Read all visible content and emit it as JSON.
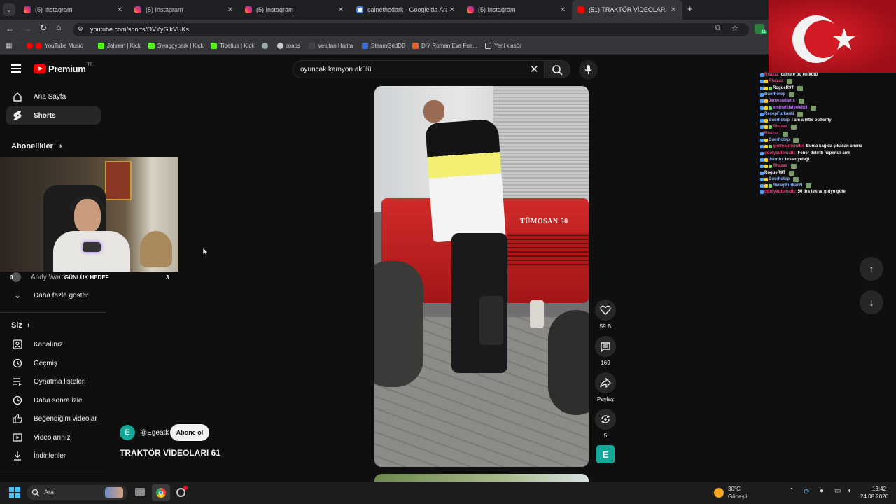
{
  "browser": {
    "tabs": [
      {
        "title": "(5) Instagram",
        "icon": "instagram-icon"
      },
      {
        "title": "(5) Instagram",
        "icon": "instagram-icon"
      },
      {
        "title": "(5) Instagram",
        "icon": "instagram-icon"
      },
      {
        "title": "cainethedark - Google'da Ara",
        "icon": "google-icon"
      },
      {
        "title": "(5) Instagram",
        "icon": "instagram-icon"
      },
      {
        "title": "(51) TRAKTÖR VİDEOLARI 6",
        "icon": "youtube-icon",
        "active": true
      }
    ],
    "new_tab": "+",
    "url": "youtube.com/shorts/OVYyGikVUKs",
    "bookmarks": [
      "YouTube Music",
      "Jahrein | Kick",
      "Swaggybark | Kick",
      "Tibetius | Kick",
      "roads",
      "Velutan Harita",
      "SteamGridDB",
      "DIY Roman Eva Foa...",
      "Yeni klasör"
    ],
    "extension_badge": "11"
  },
  "youtube": {
    "logo_text": "Premium",
    "logo_sup": "TR",
    "search_value": "oyuncak kamyon akülü",
    "nav": [
      {
        "label": "Ana Sayfa",
        "icon": "home-icon"
      },
      {
        "label": "Shorts",
        "icon": "shorts-icon",
        "active": true
      }
    ],
    "subscriptions_header": "Abonelikler",
    "subscription_partial": "Andy Ward",
    "show_more": "Daha fazla göster",
    "you_header": "Siz",
    "you_items": [
      {
        "label": "Kanalınız",
        "icon": "channel-icon"
      },
      {
        "label": "Geçmiş",
        "icon": "history-icon"
      },
      {
        "label": "Oynatma listeleri",
        "icon": "playlist-icon"
      },
      {
        "label": "Daha sonra izle",
        "icon": "clock-icon"
      },
      {
        "label": "Beğendiğim videolar",
        "icon": "like-icon"
      },
      {
        "label": "Videolarınız",
        "icon": "video-icon"
      },
      {
        "label": "İndirilenler",
        "icon": "download-icon"
      }
    ],
    "short": {
      "channel_initial": "E",
      "channel": "@Egeatk",
      "subscribe": "Abone ol",
      "title": "TRAKTÖR VİDEOLARI 61",
      "tractor_brand": "TÜMOSAN 50",
      "likes": "59 B",
      "comments": "169",
      "share": "Paylaş",
      "remix": "5",
      "avatar_initial": "E"
    }
  },
  "overlay": {
    "goal_label": "GÜNLÜK HEDEF",
    "goal_left": "0",
    "goal_right": "3"
  },
  "chat": [
    {
      "name": "Rhazaz",
      "color": "#e0457b",
      "msg": "caine e bu en kötü"
    },
    {
      "name": "Rhazaz",
      "color": "#e0457b",
      "msg": ""
    },
    {
      "name": "RogueR9T",
      "color": "#ffffff",
      "msg": ""
    },
    {
      "name": "Buerhotep",
      "color": "#8fb4ff",
      "msg": ""
    },
    {
      "name": "Jamesadams",
      "color": "#c070ff",
      "msg": ""
    },
    {
      "name": "eminehilalyelekci",
      "color": "#c070ff",
      "msg": ""
    },
    {
      "name": "RecepFurkanN",
      "color": "#8fb4ff",
      "msg": ""
    },
    {
      "name": "Buerhotep",
      "color": "#8fb4ff",
      "msg": "I am a little butterfly"
    },
    {
      "name": "Rhazaz",
      "color": "#e0457b",
      "msg": ""
    },
    {
      "name": "Rhazaz",
      "color": "#e0457b",
      "msg": ""
    },
    {
      "name": "Buerhotep",
      "color": "#8fb4ff",
      "msg": ""
    },
    {
      "name": "goofyautomatic",
      "color": "#e0457b",
      "msg": "Bunla kağıda çıkacan amına"
    },
    {
      "name": "goofyautomatic",
      "color": "#e0457b",
      "msg": "Fener delirtti hepimizi amk"
    },
    {
      "name": "dsordo",
      "color": "#8fb4ff",
      "msg": "tırsan yeleği"
    },
    {
      "name": "Rhazaz",
      "color": "#e0457b",
      "msg": ""
    },
    {
      "name": "RogueR9T",
      "color": "#ffffff",
      "msg": ""
    },
    {
      "name": "Buerhotep",
      "color": "#8fb4ff",
      "msg": ""
    },
    {
      "name": "RecepFurkanN",
      "color": "#8fb4ff",
      "msg": ""
    },
    {
      "name": "goofyautomatic",
      "color": "#e0457b",
      "msg": "50 lira tekrar giriyo göte"
    }
  ],
  "taskbar": {
    "search_placeholder": "Ara",
    "weather_temp": "30°C",
    "weather_desc": "Güneşli",
    "time": "13:42",
    "date": "24.08.2026"
  }
}
